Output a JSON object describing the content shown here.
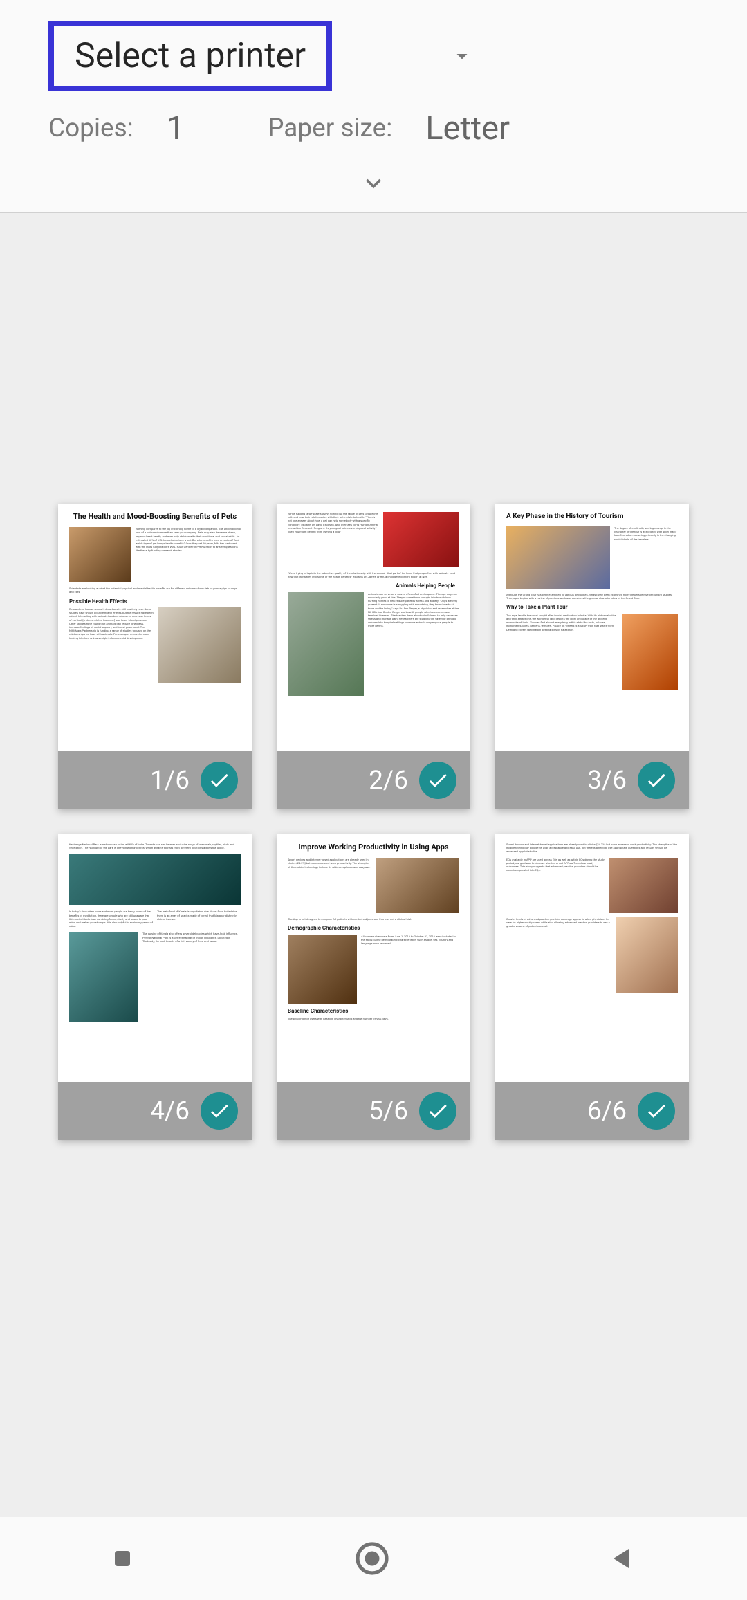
{
  "header": {
    "printer_label": "Select a printer",
    "copies_label": "Copies:",
    "copies_value": "1",
    "paper_label": "Paper size:",
    "paper_value": "Letter"
  },
  "pages": [
    {
      "num": "1/6",
      "selected": true,
      "title": "The Health and Mood-Boosting Benefits of Pets",
      "sub1": "Possible Health Effects"
    },
    {
      "num": "2/6",
      "selected": true,
      "title": "",
      "sub1": "Animals Helping People"
    },
    {
      "num": "3/6",
      "selected": true,
      "title": "A Key Phase in the History of Tourism",
      "sub1": "Why to Take a Plant Tour"
    },
    {
      "num": "4/6",
      "selected": true,
      "title": "",
      "sub1": ""
    },
    {
      "num": "5/6",
      "selected": true,
      "title": "Improve Working Productivity in Using Apps",
      "sub1": "Demographic Characteristics",
      "sub2": "Baseline Characteristics"
    },
    {
      "num": "6/6",
      "selected": true,
      "title": "",
      "sub1": ""
    }
  ]
}
